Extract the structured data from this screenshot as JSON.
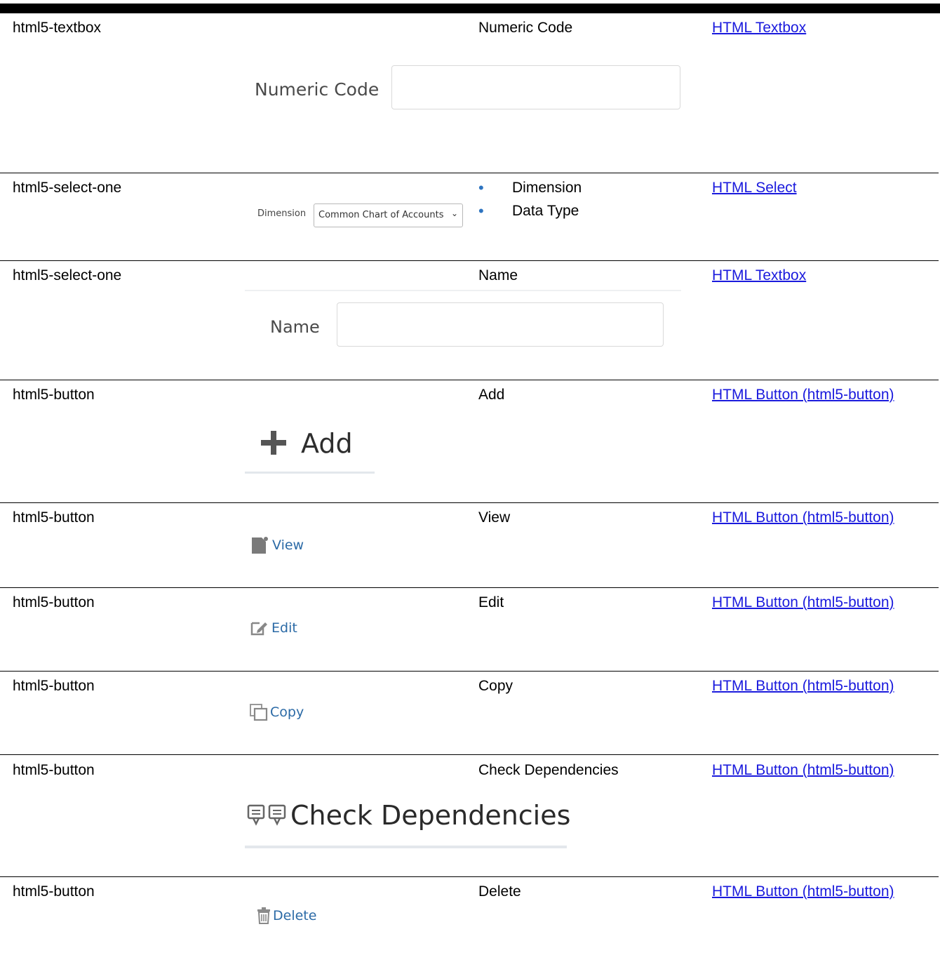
{
  "rows": [
    {
      "type": "html5-textbox",
      "label": "Numeric Code",
      "link": "HTML Textbox",
      "mock": {
        "field_label": "Numeric Code"
      }
    },
    {
      "type": "html5-select-one",
      "labels": [
        "Dimension",
        "Data Type"
      ],
      "link": "HTML Select",
      "mock": {
        "field_label": "Dimension",
        "selected": "Common Chart of Accounts"
      }
    },
    {
      "type": "html5-select-one",
      "label": "Name",
      "link": "HTML Textbox",
      "mock": {
        "field_label": "Name"
      }
    },
    {
      "type": "html5-button",
      "label": "Add",
      "link": "HTML Button (html5-button)",
      "mock": {
        "text": "Add",
        "icon": "plus-icon"
      }
    },
    {
      "type": "html5-button",
      "label": "View",
      "link": "HTML Button (html5-button)",
      "mock": {
        "text": "View",
        "icon": "document-icon"
      }
    },
    {
      "type": "html5-button",
      "label": "Edit",
      "link": "HTML Button (html5-button)",
      "mock": {
        "text": "Edit",
        "icon": "pencil-square-icon"
      }
    },
    {
      "type": "html5-button",
      "label": "Copy",
      "link": "HTML Button (html5-button)",
      "mock": {
        "text": "Copy",
        "icon": "copy-icon"
      }
    },
    {
      "type": "html5-button",
      "label": "Check Dependencies",
      "link": "HTML Button (html5-button)",
      "mock": {
        "text": "Check Dependencies",
        "icon": "dependencies-icon"
      }
    },
    {
      "type": "html5-button",
      "label": "Delete",
      "link": "HTML Button (html5-button)",
      "mock": {
        "text": "Delete",
        "icon": "trash-icon"
      }
    }
  ],
  "colors": {
    "link": "#1a1add",
    "bullet": "#2e74c0",
    "button_text": "#2b6aa6",
    "icon_gray": "#7a7a7a"
  }
}
